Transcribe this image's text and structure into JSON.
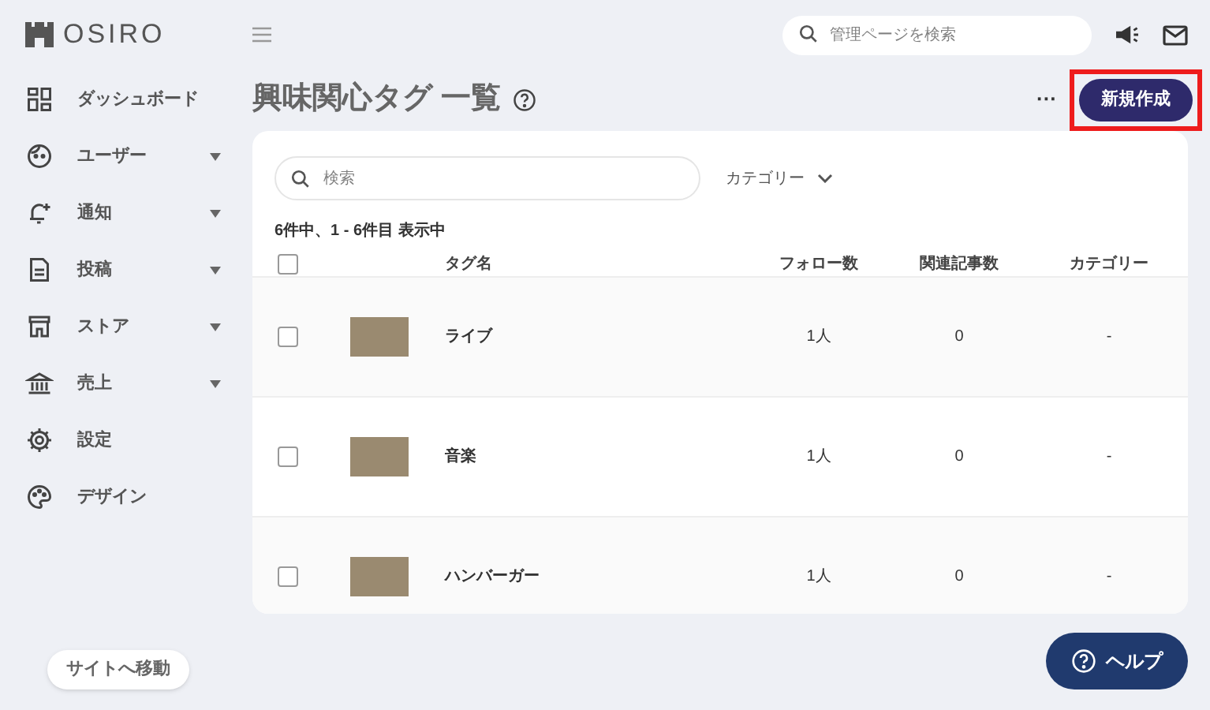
{
  "logo": {
    "text": "OSIRO"
  },
  "header": {
    "search": {
      "placeholder": "管理ページを検索"
    }
  },
  "sidebar": {
    "items": [
      {
        "label": "ダッシュボード",
        "has_submenu": false
      },
      {
        "label": "ユーザー",
        "has_submenu": true
      },
      {
        "label": "通知",
        "has_submenu": true
      },
      {
        "label": "投稿",
        "has_submenu": true
      },
      {
        "label": "ストア",
        "has_submenu": true
      },
      {
        "label": "売上",
        "has_submenu": true
      },
      {
        "label": "設定",
        "has_submenu": false
      },
      {
        "label": "デザイン",
        "has_submenu": false
      }
    ],
    "site_button": "サイトへ移動"
  },
  "page": {
    "title": "興味関心タグ 一覧",
    "more": "···",
    "new_button": "新規作成"
  },
  "filters": {
    "search": {
      "placeholder": "検索"
    },
    "category": "カテゴリー"
  },
  "result_count": "6件中、1 - 6件目 表示中",
  "table": {
    "select_all": {
      "checked": false
    },
    "columns": [
      "タグ名",
      "フォロー数",
      "関連記事数",
      "カテゴリー"
    ],
    "rows": [
      {
        "checked": false,
        "name": "ライブ",
        "follows": "1人",
        "articles": "0",
        "category": "-"
      },
      {
        "checked": false,
        "name": "音楽",
        "follows": "1人",
        "articles": "0",
        "category": "-"
      },
      {
        "checked": false,
        "name": "ハンバーガー",
        "follows": "1人",
        "articles": "0",
        "category": "-"
      }
    ]
  },
  "help_button": "ヘルプ"
}
